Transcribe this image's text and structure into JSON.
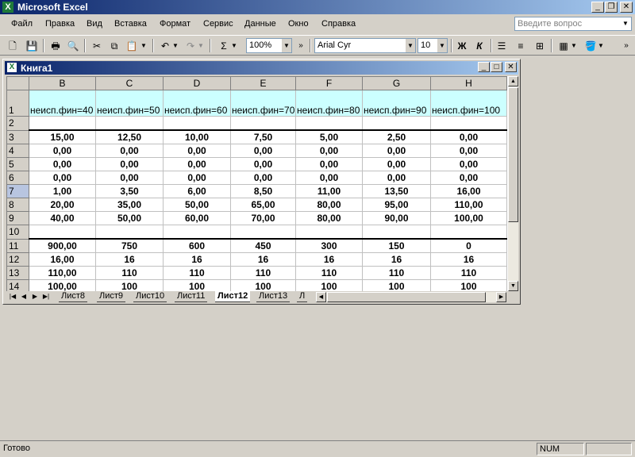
{
  "app": {
    "title": "Microsoft Excel"
  },
  "menu": [
    "Файл",
    "Правка",
    "Вид",
    "Вставка",
    "Формат",
    "Сервис",
    "Данные",
    "Окно",
    "Справка"
  ],
  "help_box": {
    "placeholder": "Введите вопрос"
  },
  "toolbar": {
    "zoom": "100%",
    "font_name": "Arial Cyr",
    "font_size": "10",
    "bold": "Ж",
    "italic": "К"
  },
  "workbook": {
    "title": "Книга1"
  },
  "columns": [
    "B",
    "C",
    "D",
    "E",
    "F",
    "G",
    "H"
  ],
  "row1": [
    "неисп.фин=40",
    "неисп.фин=50",
    "неисп.фин=60",
    "неисп.фин=70",
    "неисп.фин=80",
    "неисп.фин=90",
    "неисп.фин=100"
  ],
  "rows": [
    {
      "n": "1"
    },
    {
      "n": "2",
      "cells": [
        "",
        "",
        "",
        "",
        "",
        "",
        ""
      ]
    },
    {
      "n": "3",
      "cells": [
        "15,00",
        "12,50",
        "10,00",
        "7,50",
        "5,00",
        "2,50",
        "0,00"
      ]
    },
    {
      "n": "4",
      "cells": [
        "0,00",
        "0,00",
        "0,00",
        "0,00",
        "0,00",
        "0,00",
        "0,00"
      ]
    },
    {
      "n": "5",
      "cells": [
        "0,00",
        "0,00",
        "0,00",
        "0,00",
        "0,00",
        "0,00",
        "0,00"
      ]
    },
    {
      "n": "6",
      "cells": [
        "0,00",
        "0,00",
        "0,00",
        "0,00",
        "0,00",
        "0,00",
        "0,00"
      ]
    },
    {
      "n": "7",
      "cells": [
        "1,00",
        "3,50",
        "6,00",
        "8,50",
        "11,00",
        "13,50",
        "16,00"
      ]
    },
    {
      "n": "8",
      "cells": [
        "20,00",
        "35,00",
        "50,00",
        "65,00",
        "80,00",
        "95,00",
        "110,00"
      ]
    },
    {
      "n": "9",
      "cells": [
        "40,00",
        "50,00",
        "60,00",
        "70,00",
        "80,00",
        "90,00",
        "100,00"
      ]
    },
    {
      "n": "10",
      "cells": [
        "",
        "",
        "",
        "",
        "",
        "",
        ""
      ]
    },
    {
      "n": "11",
      "cells": [
        "900,00",
        "750",
        "600",
        "450",
        "300",
        "150",
        "0"
      ]
    },
    {
      "n": "12",
      "cells": [
        "16,00",
        "16",
        "16",
        "16",
        "16",
        "16",
        "16"
      ]
    },
    {
      "n": "13",
      "cells": [
        "110,00",
        "110",
        "110",
        "110",
        "110",
        "110",
        "110"
      ]
    },
    {
      "n": "14",
      "cells": [
        "100,00",
        "100",
        "100",
        "100",
        "100",
        "100",
        "100"
      ]
    }
  ],
  "sheet_tabs": [
    "Лист8",
    "Лист9",
    "Лист10",
    "Лист11",
    "Лист12",
    "Лист13",
    "Л"
  ],
  "active_tab": "Лист12",
  "status": {
    "text": "Готово",
    "num": "NUM"
  }
}
